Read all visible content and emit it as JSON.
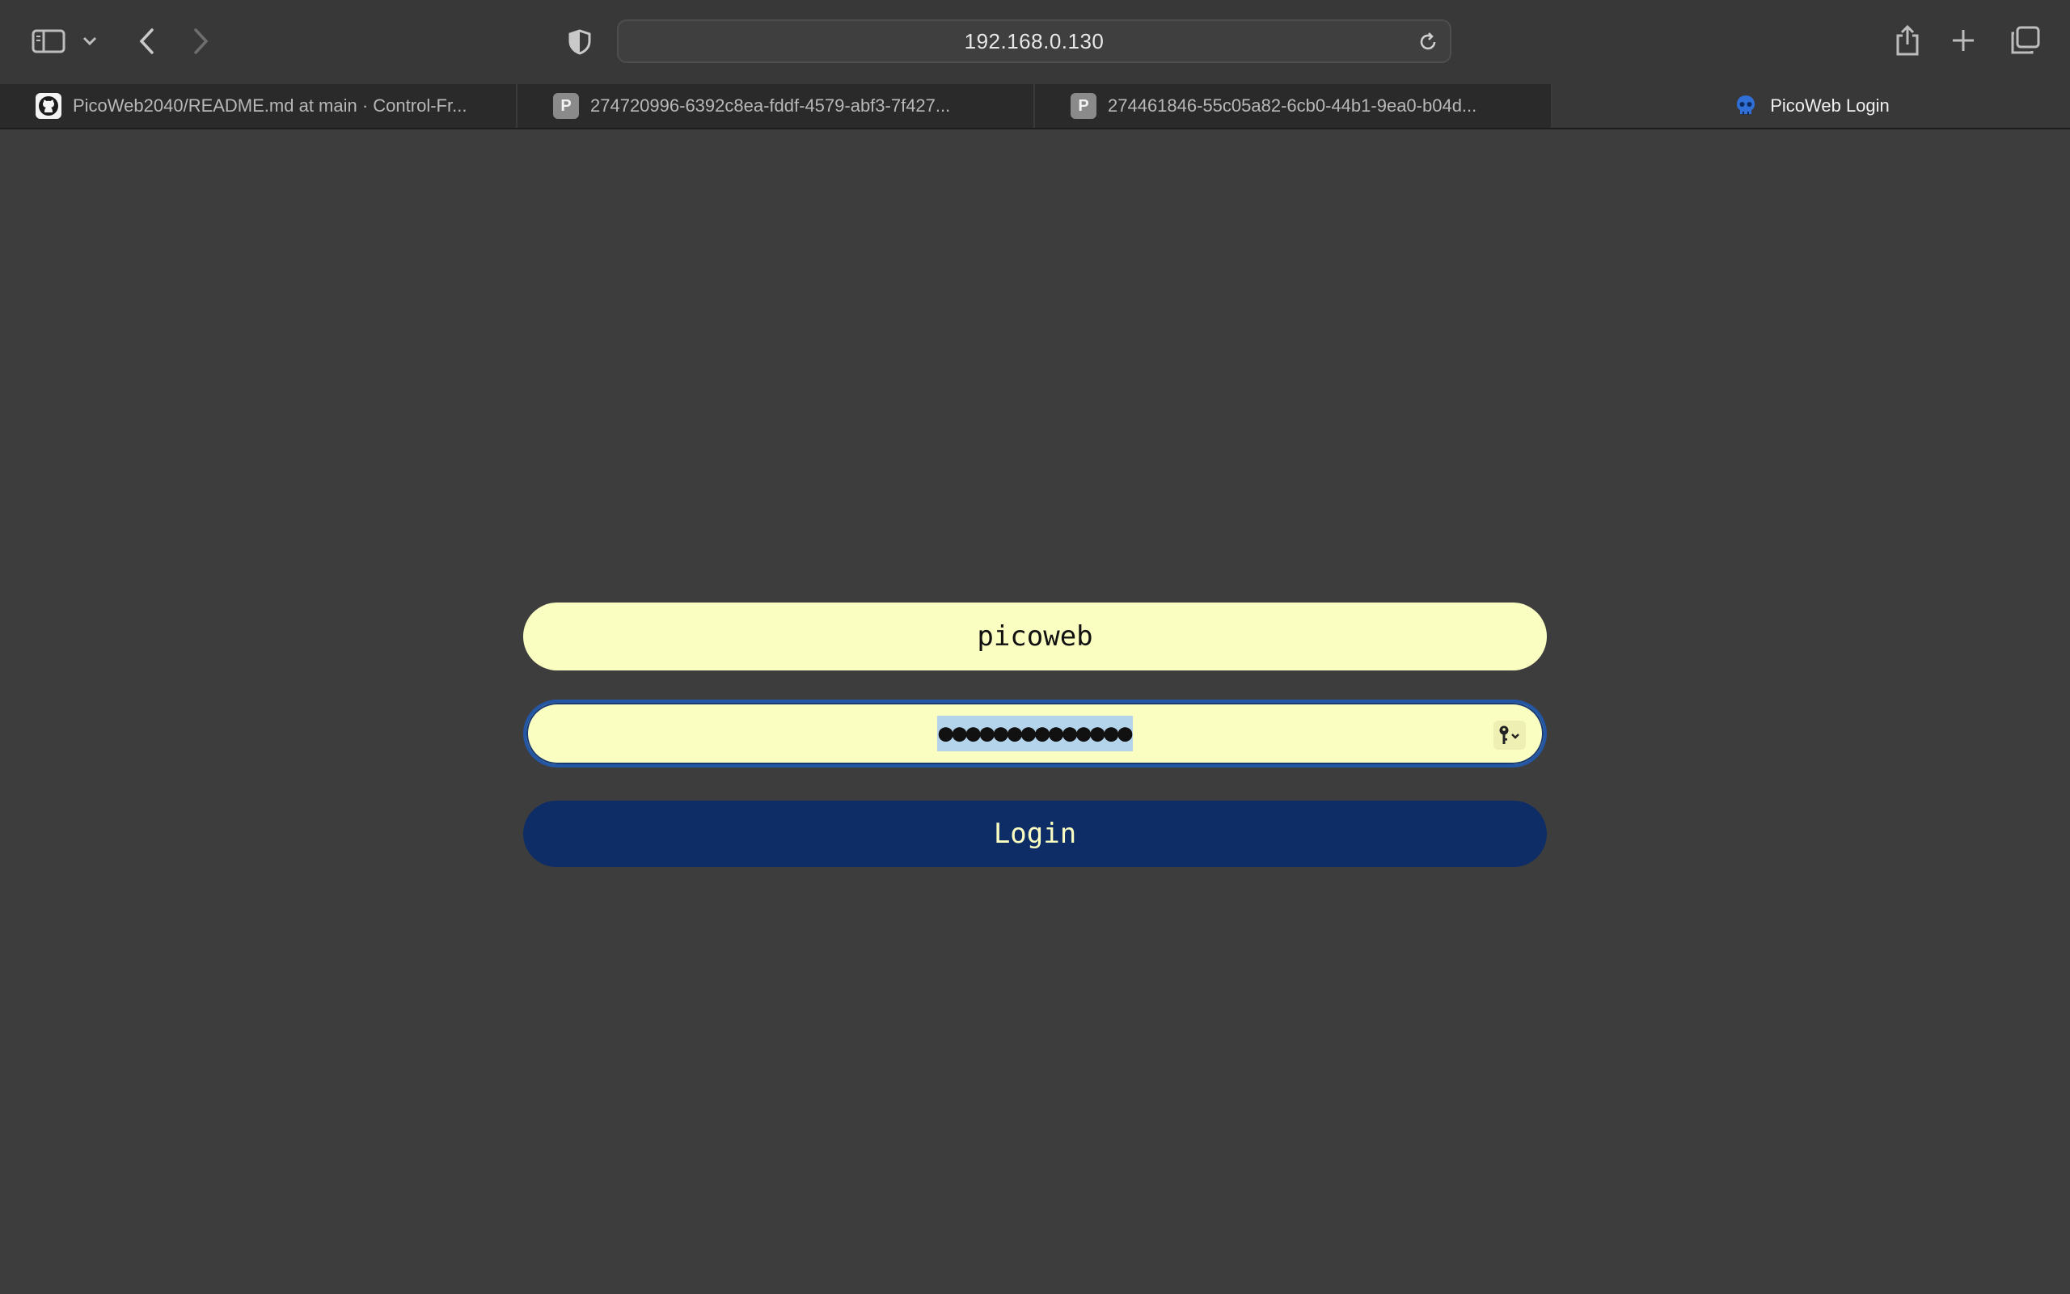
{
  "browser": {
    "url": "192.168.0.130",
    "tabs": [
      {
        "title": "PicoWeb2040/README.md at main · Control-Fr...",
        "favicon": "github-icon",
        "active": false
      },
      {
        "title": "274720996-6392c8ea-fddf-4579-abf3-7f427...",
        "favicon": "P",
        "active": false
      },
      {
        "title": "274461846-55c05a82-6cb0-44b1-9ea0-b04d...",
        "favicon": "P",
        "active": false
      },
      {
        "title": "PicoWeb Login",
        "favicon": "picoweb-skull-icon",
        "active": true
      }
    ]
  },
  "login_form": {
    "username_value": "picoweb",
    "password_masked": "●●●●●●●●●●●●●●",
    "login_label": "Login"
  },
  "colors": {
    "page_background": "#3d3d3d",
    "field_background": "#fafec1",
    "button_background": "#0e2d67",
    "focus_ring": "#2456a6",
    "selection_highlight": "#b4d4ec"
  }
}
